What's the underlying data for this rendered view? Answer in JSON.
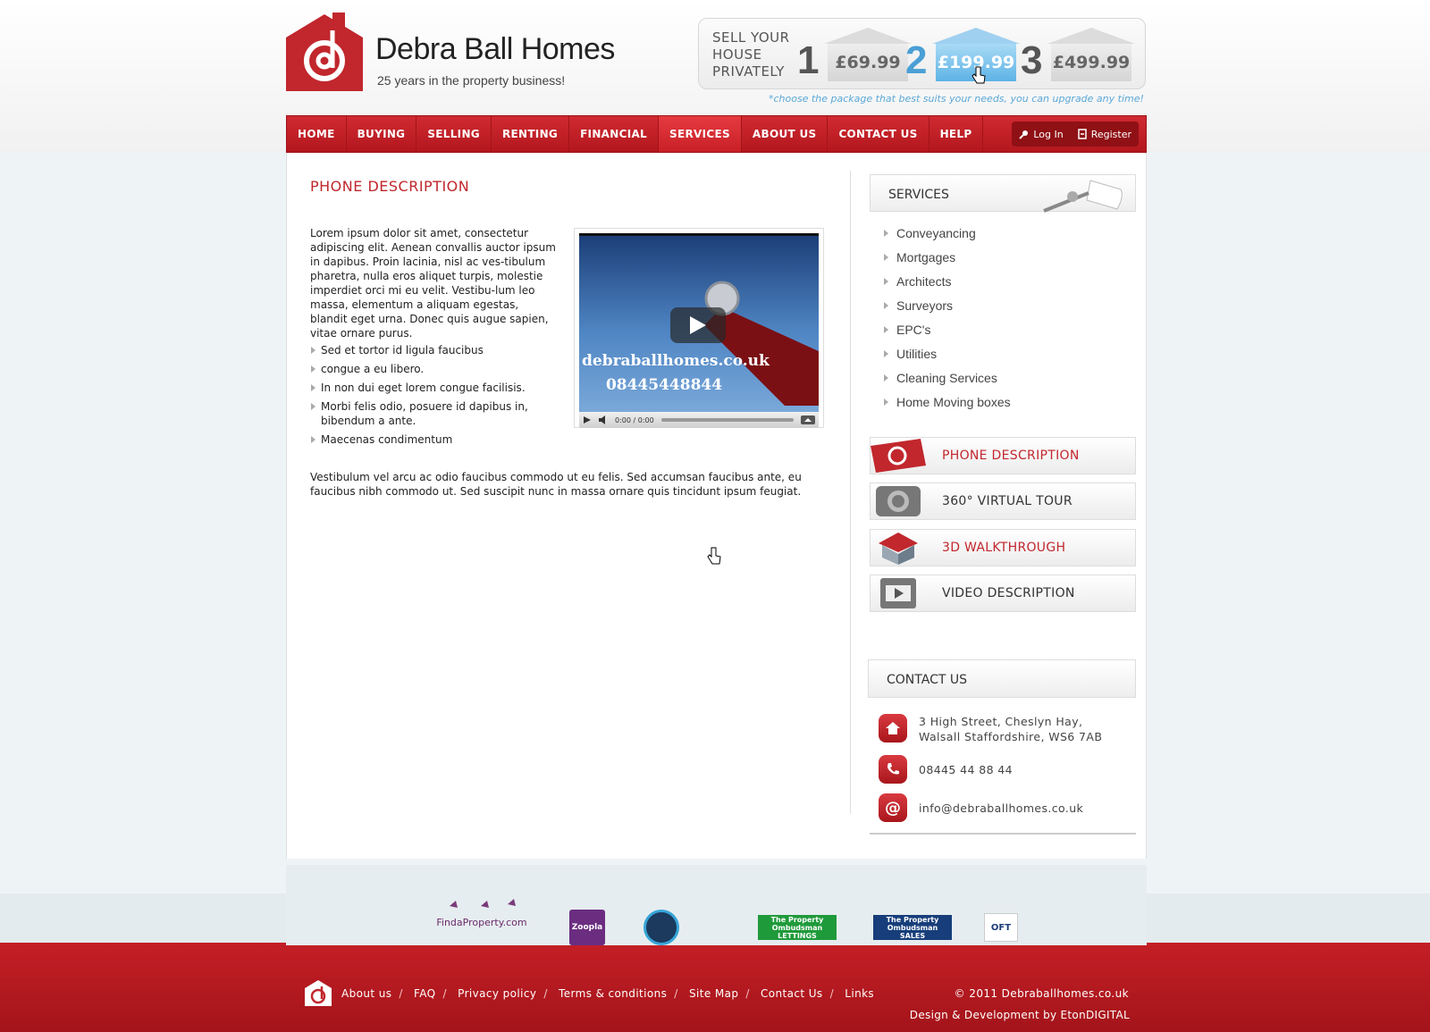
{
  "header": {
    "brand": "Debra Ball Homes",
    "tagline": "25 years in the property business!",
    "promo": {
      "text": "SELL YOUR HOUSE PRIVATELY",
      "packages": [
        {
          "num": "1",
          "price": "£69.99"
        },
        {
          "num": "2",
          "price": "£199.99"
        },
        {
          "num": "3",
          "price": "£499.99"
        }
      ],
      "note": "*choose the package that best suits your needs, you can upgrade any time!"
    }
  },
  "nav": {
    "items": [
      "HOME",
      "BUYING",
      "SELLING",
      "RENTING",
      "FINANCIAL",
      "SERVICES",
      "ABOUT US",
      "CONTACT US",
      "HELP"
    ],
    "active": "SERVICES",
    "login": "Log In",
    "register": "Register"
  },
  "content": {
    "title": "PHONE DESCRIPTION",
    "intro": "Lorem ipsum dolor sit amet, consectetur adipiscing elit. Aenean convallis auctor ipsum in dapibus. Proin lacinia, nisl ac ves-tibulum pharetra, nulla eros aliquet turpis, molestie imperdiet orci mi eu velit. Vestibu-lum leo massa, elementum a aliquam egestas, blandit eget urna. Donec quis augue sapien, vitae ornare purus.",
    "bullets": [
      "Sed et tortor id ligula faucibus",
      "congue a eu libero.",
      "In non dui eget lorem congue facilisis.",
      "Morbi felis odio, posuere id dapibus in, bibendum a ante.",
      "Maecenas condimentum"
    ],
    "para2": "Vestibulum vel arcu ac odio faucibus commodo ut eu felis. Sed accumsan faucibus ante, eu faucibus nibh commodo ut. Sed suscipit nunc in massa ornare quis tincidunt ipsum feugiat.",
    "video": {
      "url": "debraballhomes.co.uk",
      "phone": "08445448844",
      "time": "0:00 / 0:00"
    }
  },
  "sidebar": {
    "services_title": "SERVICES",
    "services": [
      "Conveyancing",
      "Mortgages",
      "Architects",
      "Surveyors",
      "EPC's",
      "Utilities",
      "Cleaning Services",
      "Home Moving boxes"
    ],
    "buttons": [
      "PHONE DESCRIPTION",
      "360° VIRTUAL TOUR",
      "3D WALKTHROUGH",
      "VIDEO DESCRIPTION"
    ],
    "contact_title": "CONTACT US",
    "address_line1": "3 High Street, Cheslyn Hay,",
    "address_line2": "Walsall Staffordshire, WS6 7AB",
    "phone": "08445 44 88 44",
    "email": "info@debraballhomes.co.uk"
  },
  "partners": {
    "findaproperty": "FindaProperty.com",
    "zoopla": "Zoopla",
    "ombudsman_lettings": "The Property Ombudsman",
    "lettings": "LETTINGS",
    "ombudsman_sales": "The Property Ombudsman",
    "sales": "SALES",
    "oft": "OFT"
  },
  "footer": {
    "links": [
      "About us",
      "FAQ",
      "Privacy policy",
      "Terms & conditions",
      "Site Map",
      "Contact Us",
      "Links"
    ],
    "copyright": "© 2011 Debraballhomes.co.uk",
    "credit": "Design & Development by EtonDIGITAL"
  },
  "colors": {
    "brand_red": "#c1272d",
    "accent_blue": "#4a9fd5"
  }
}
